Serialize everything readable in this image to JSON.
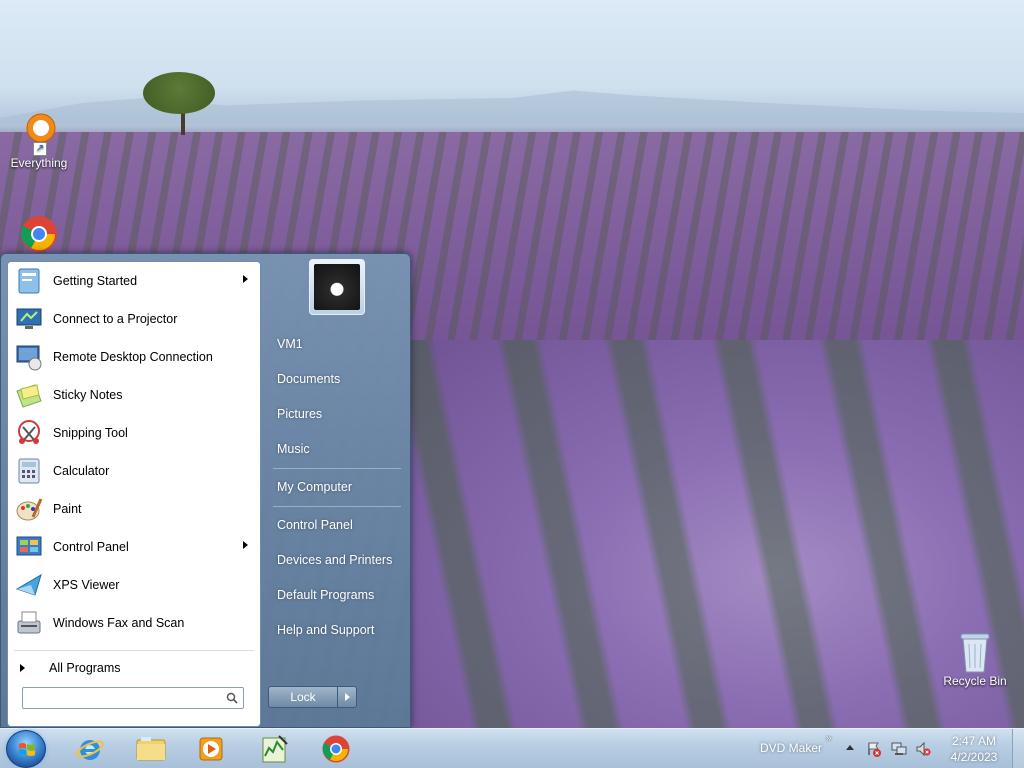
{
  "desktop": {
    "icons": [
      {
        "label": "Everything",
        "icon": "everything-icon"
      },
      {
        "label": "",
        "icon": "chrome-icon"
      },
      {
        "label": "Recycle Bin",
        "icon": "recycle-bin-icon"
      }
    ]
  },
  "start_menu": {
    "programs": [
      {
        "label": "Getting Started",
        "icon": "getting-started-icon",
        "has_submenu": true
      },
      {
        "label": "Connect to a Projector",
        "icon": "projector-icon",
        "has_submenu": false
      },
      {
        "label": "Remote Desktop Connection",
        "icon": "remote-desktop-icon",
        "has_submenu": false
      },
      {
        "label": "Sticky Notes",
        "icon": "sticky-notes-icon",
        "has_submenu": false
      },
      {
        "label": "Snipping Tool",
        "icon": "snipping-tool-icon",
        "has_submenu": false
      },
      {
        "label": "Calculator",
        "icon": "calculator-icon",
        "has_submenu": false
      },
      {
        "label": "Paint",
        "icon": "paint-icon",
        "has_submenu": false
      },
      {
        "label": "Control Panel",
        "icon": "control-panel-icon",
        "has_submenu": true
      },
      {
        "label": "XPS Viewer",
        "icon": "xps-viewer-icon",
        "has_submenu": false
      },
      {
        "label": "Windows Fax and Scan",
        "icon": "fax-scan-icon",
        "has_submenu": false
      }
    ],
    "all_programs_label": "All Programs",
    "search": {
      "value": "",
      "placeholder": ""
    },
    "right_items": [
      "VM1",
      "Documents",
      "Pictures",
      "Music",
      "My Computer",
      "Control Panel",
      "Devices and Printers",
      "Default Programs",
      "Help and Support"
    ],
    "lock_label": "Lock"
  },
  "taskbar": {
    "pinned": [
      "internet-explorer-icon",
      "file-explorer-icon",
      "media-player-icon",
      "task-manager-icon",
      "chrome-icon"
    ],
    "toolbar_label": "DVD Maker",
    "clock_time": "2:47 AM",
    "clock_date": "4/2/2023"
  },
  "colors": {
    "taskbar": "#b7cde3",
    "start_menu_right": "#7896b4",
    "accent": "#1d4f9a"
  }
}
